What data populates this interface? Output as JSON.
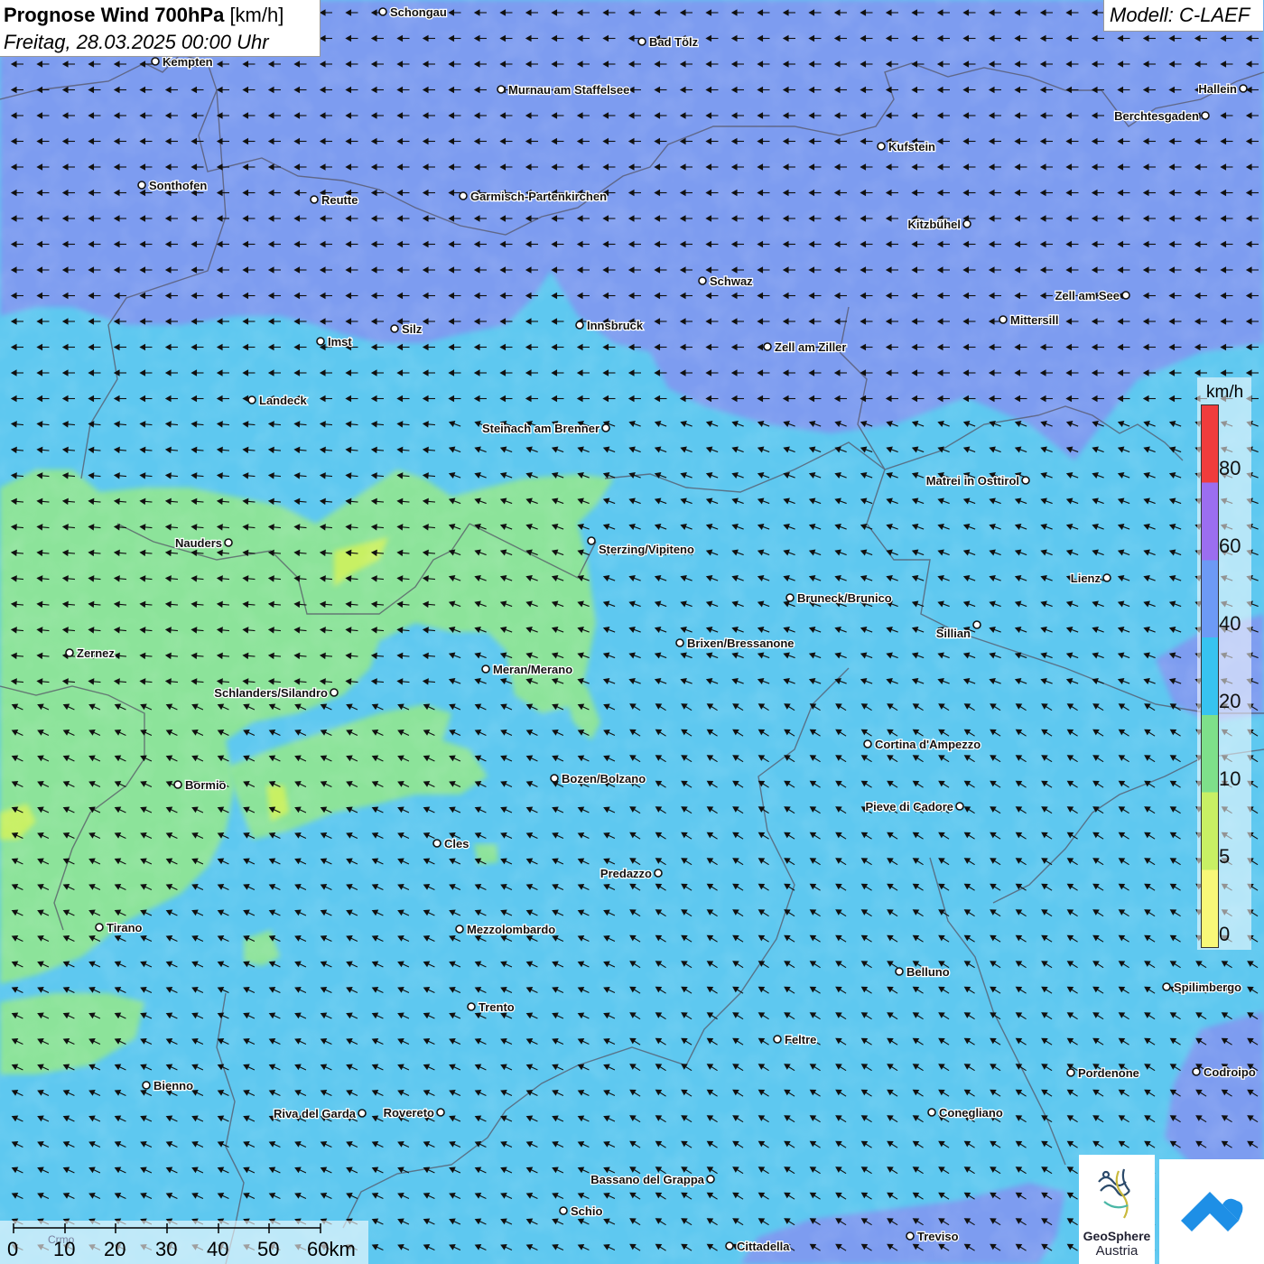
{
  "header": {
    "title_bold": "Prognose Wind 700hPa",
    "title_unit": "[km/h]",
    "subtitle": "Freitag, 28.03.2025 00:00 Uhr",
    "model": "Modell: C-LAEF"
  },
  "legend": {
    "unit": "km/h",
    "labels": [
      "80",
      "60",
      "40",
      "20",
      "10",
      "5",
      "0"
    ],
    "colors": [
      "#f03c3c",
      "#9b6ef0",
      "#6d9af5",
      "#37c3f0",
      "#7ee08a",
      "#c8f064",
      "#f8f878"
    ]
  },
  "scale_bar": {
    "labels": [
      "0",
      "10",
      "20",
      "30",
      "40",
      "50",
      "60km"
    ],
    "faint_label": "Crmo"
  },
  "logos": {
    "geosphere_line1": "GeoSphere",
    "geosphere_line2": "Austria"
  },
  "cities": [
    {
      "name": "Schongau"
    },
    {
      "name": "Bad Tölz"
    },
    {
      "name": "Kempten"
    },
    {
      "name": "Murnau am Staffelsee"
    },
    {
      "name": "Hallein"
    },
    {
      "name": "Berchtesgaden"
    },
    {
      "name": "Kufstein"
    },
    {
      "name": "Sonthofen"
    },
    {
      "name": "Reutte"
    },
    {
      "name": "Garmisch-Partenkirchen"
    },
    {
      "name": "Kitzbühel"
    },
    {
      "name": "Schwaz"
    },
    {
      "name": "Zell am See"
    },
    {
      "name": "Mittersill"
    },
    {
      "name": "Imst"
    },
    {
      "name": "Silz"
    },
    {
      "name": "Innsbruck"
    },
    {
      "name": "Zell am Ziller"
    },
    {
      "name": "Landeck"
    },
    {
      "name": "Steinach am Brenner"
    },
    {
      "name": "Matrei in Osttirol"
    },
    {
      "name": "Nauders"
    },
    {
      "name": "Sterzing/Vipiteno"
    },
    {
      "name": "Lienz"
    },
    {
      "name": "Bruneck/Brunico"
    },
    {
      "name": "Sillian"
    },
    {
      "name": "Zernez"
    },
    {
      "name": "Brixen/Bressanone"
    },
    {
      "name": "Meran/Merano"
    },
    {
      "name": "Schlanders/Silandro"
    },
    {
      "name": "Cortina d'Ampezzo"
    },
    {
      "name": "Bormio"
    },
    {
      "name": "Bozen/Bolzano"
    },
    {
      "name": "Pieve di Cadore"
    },
    {
      "name": "Cles"
    },
    {
      "name": "Predazzo"
    },
    {
      "name": "Tirano"
    },
    {
      "name": "Mezzolombardo"
    },
    {
      "name": "Belluno"
    },
    {
      "name": "Spilimbergo"
    },
    {
      "name": "Trento"
    },
    {
      "name": "Feltre"
    },
    {
      "name": "Bienno"
    },
    {
      "name": "Pordenone"
    },
    {
      "name": "Codroipo"
    },
    {
      "name": "Riva del Garda"
    },
    {
      "name": "Rovereto"
    },
    {
      "name": "Conegliano"
    },
    {
      "name": "Bassano del Grappa"
    },
    {
      "name": "Schio"
    },
    {
      "name": "Treviso"
    },
    {
      "name": "Cittadella"
    }
  ],
  "wind": {
    "prevailing_direction": "from east-northeast"
  }
}
